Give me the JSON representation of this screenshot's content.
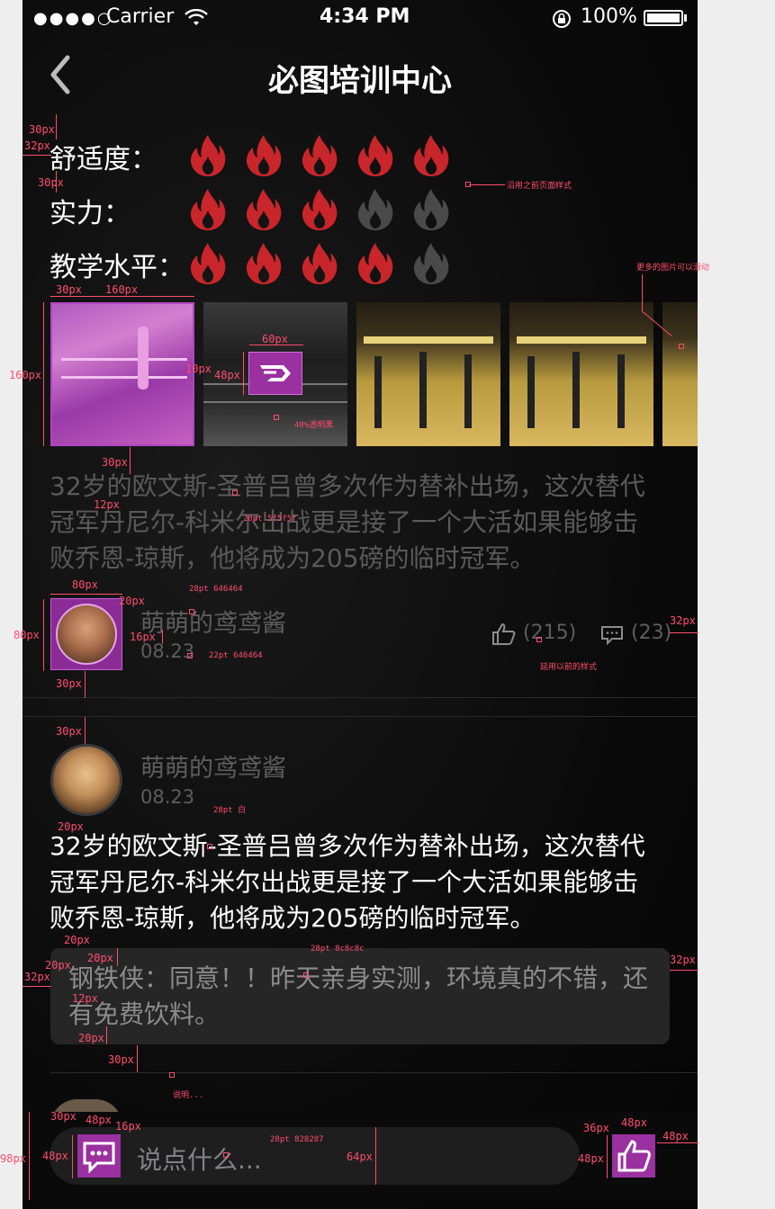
{
  "status": {
    "carrier": "Carrier",
    "time": "4:34 PM",
    "battery": "100%"
  },
  "header": {
    "title": "必图培训中心"
  },
  "ratings": [
    {
      "label": "舒适度：",
      "score": 5,
      "max": 5
    },
    {
      "label": "实力：",
      "score": 3,
      "max": 5
    },
    {
      "label": "教学水平：",
      "score": 4,
      "max": 5
    }
  ],
  "comment1": {
    "text": [
      "32岁的欧文斯-圣普吕曾多次作为替补出场，这次替代",
      "冠军丹尼尔-科米尔出战更是接了一个大活如果能够击",
      "败乔恩-琼斯，他将成为205磅的临时冠军。"
    ],
    "user": "萌萌的鸢鸢酱",
    "date": "08.23",
    "likes": "(215)",
    "comments": "(23)"
  },
  "comment2": {
    "user": "萌萌的鸢鸢酱",
    "date": "08.23",
    "text": [
      "32岁的欧文斯-圣普吕曾多次作为替补出场，这次替代",
      "冠军丹尼尔-科米尔出战更是接了一个大活如果能够击",
      "败乔恩-琼斯，他将成为205磅的临时冠军。"
    ],
    "reply": [
      "钢铁侠：同意！！昨天亲身实测，环境真的不错，还",
      "有免费饮料。"
    ]
  },
  "input": {
    "placeholder": "说点什么..."
  },
  "colors": {
    "fire_active": "#c8262b",
    "fire_inactive": "#4a4a4a",
    "accent": "#9b30a0",
    "annotation": "#ff4d6d"
  },
  "annotations": {
    "a30_1": "30px",
    "a32_1": "32px",
    "a30_2": "30px",
    "note_old": "沿用之前页面样式",
    "note_scroll": "更多的图片可以滑动",
    "g30": "30px",
    "g160": "160px",
    "g160v": "160px",
    "g60": "60px",
    "g10": "10px",
    "g48": "48px",
    "note_opacity": "40%透明黑",
    "g30b": "30px",
    "g12": "12px",
    "t28a": "28pt 5f5f5f",
    "a80h": "80px",
    "a20a": "20px",
    "t28b": "28pt 646464",
    "a80v": "80px",
    "a16": "16px",
    "t22": "22pt 646464",
    "a30c": "30px",
    "note_reuse": "延用以前的样式",
    "a32b": "32px",
    "a30d": "30px",
    "t28white": "28pt 白",
    "a20b": "20px",
    "r20a": "20px",
    "r20b": "20px",
    "r32a": "32px",
    "r20c": "20px",
    "r12": "12px",
    "t28c": "28pt 8c8c8c",
    "r32b": "32px",
    "r20d": "20px",
    "r30": "30px",
    "note_desc": "说明...",
    "b30": "30px",
    "b48a": "48px",
    "b16": "16px",
    "b98": "98px",
    "b48b": "48px",
    "t28d": "28pt 828287",
    "b64": "64px",
    "b36": "36px",
    "b48c": "48px",
    "b48d": "48px",
    "b48e": "48px"
  }
}
